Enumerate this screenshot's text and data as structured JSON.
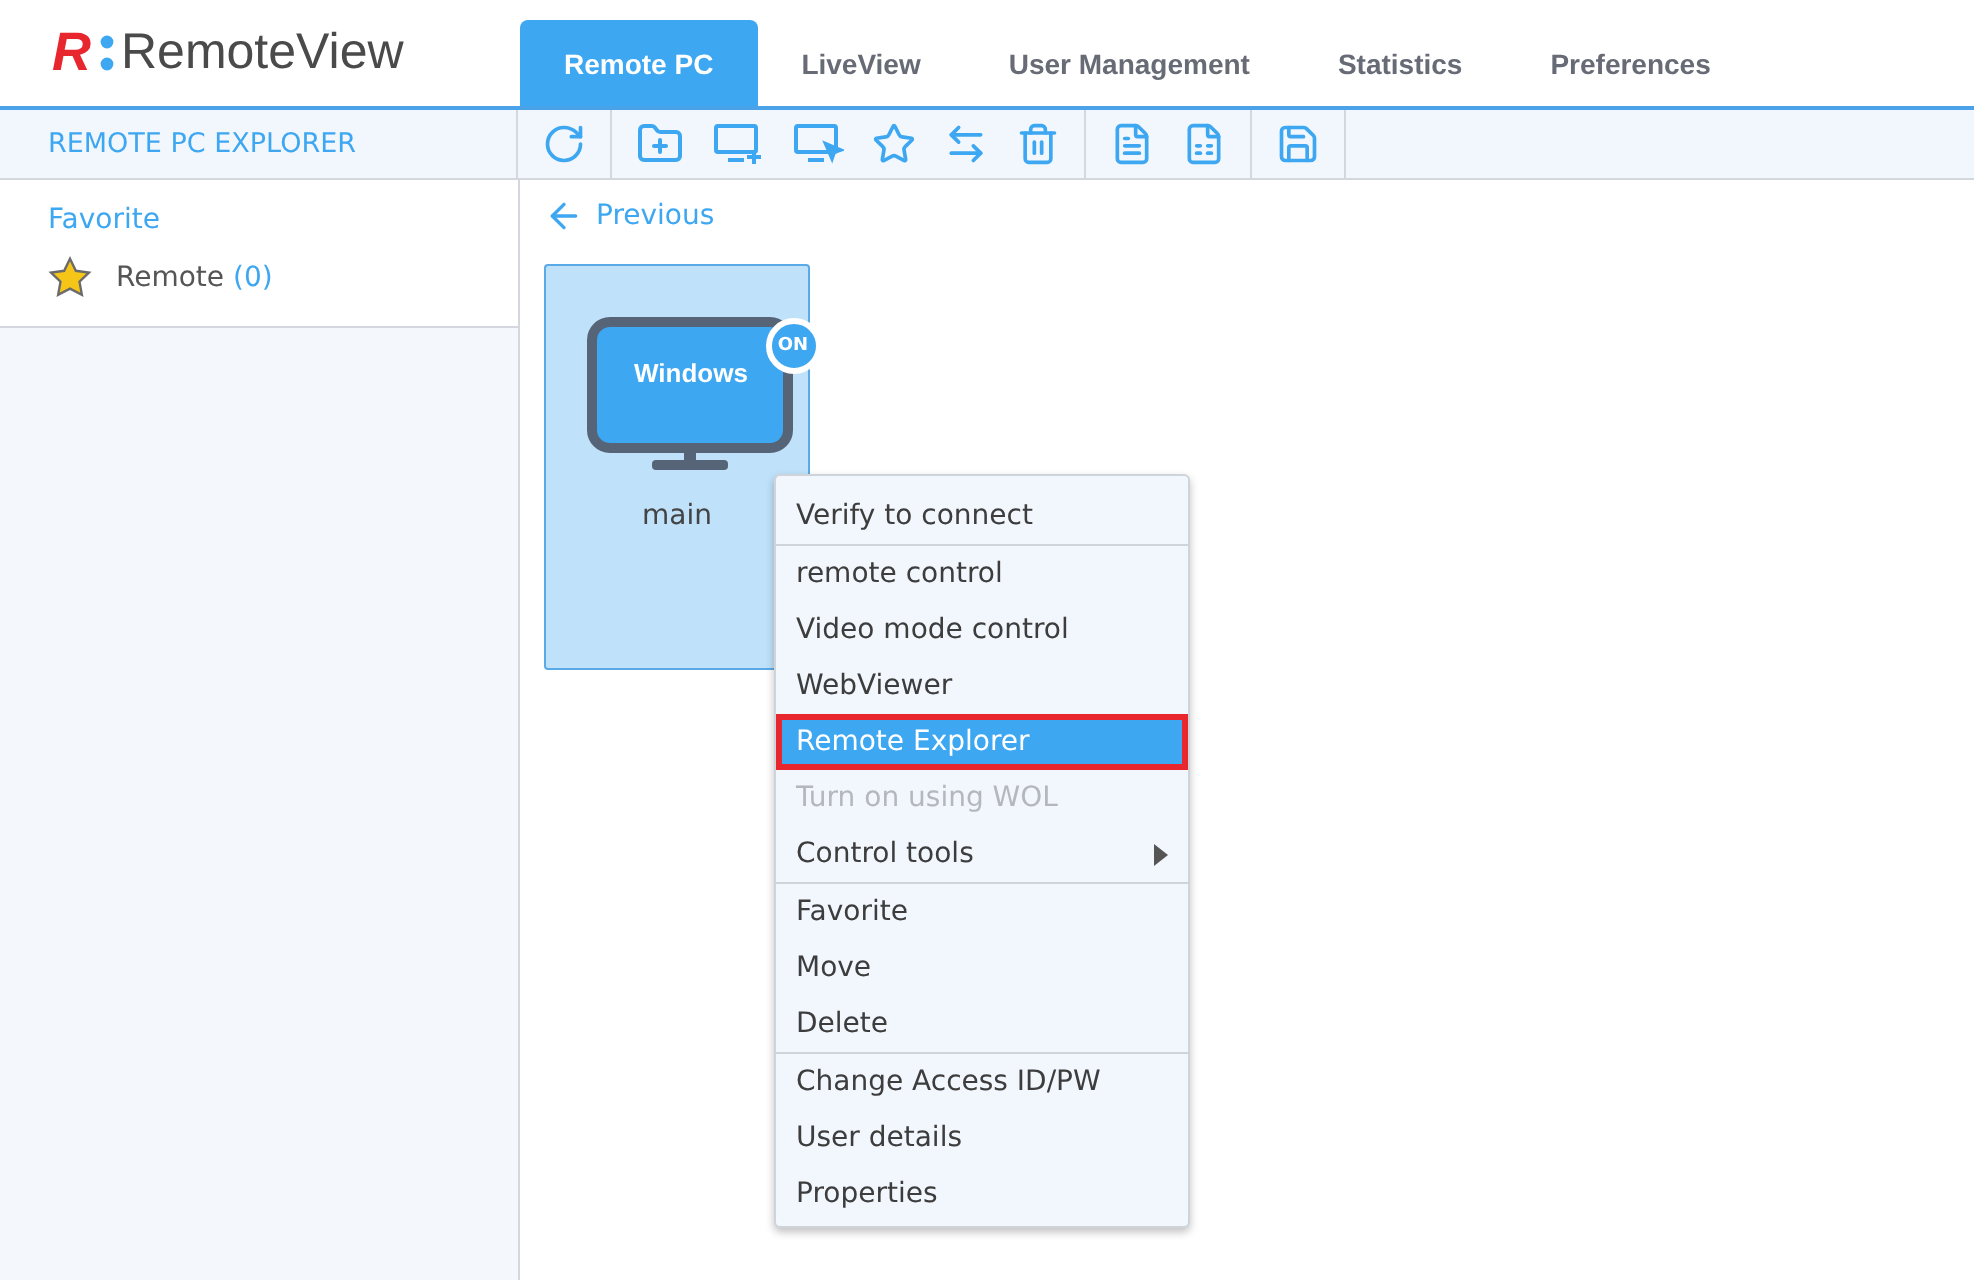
{
  "logo": {
    "mark": "R",
    "name": "RemoteView"
  },
  "tabs": [
    {
      "label": "Remote PC",
      "selected": true
    },
    {
      "label": "LiveView",
      "selected": false
    },
    {
      "label": "User Management",
      "selected": false
    },
    {
      "label": "Statistics",
      "selected": false
    },
    {
      "label": "Preferences",
      "selected": false
    }
  ],
  "sidebar": {
    "title": "REMOTE PC EXPLORER",
    "section": "Favorite",
    "items": [
      {
        "label": "Remote",
        "count": "(0)"
      }
    ]
  },
  "nav": {
    "back": "Previous"
  },
  "devices": [
    {
      "screen_text": "Windows",
      "status": "ON",
      "on": true,
      "name": "main",
      "selected": true
    }
  ],
  "context_menu": [
    [
      {
        "label": "Verify to connect",
        "disabled": false,
        "selected": false,
        "outlined": false,
        "submenu": false
      }
    ],
    [
      {
        "label": "remote control",
        "disabled": false,
        "selected": false,
        "outlined": false,
        "submenu": false
      },
      {
        "label": "Video mode control",
        "disabled": false,
        "selected": false,
        "outlined": false,
        "submenu": false
      },
      {
        "label": "WebViewer",
        "disabled": false,
        "selected": false,
        "outlined": false,
        "submenu": false
      },
      {
        "label": "Remote Explorer",
        "disabled": false,
        "selected": true,
        "outlined": true,
        "submenu": false
      },
      {
        "label": "Turn on using WOL",
        "disabled": true,
        "selected": false,
        "outlined": false,
        "submenu": false
      },
      {
        "label": "Control tools",
        "disabled": false,
        "selected": false,
        "outlined": false,
        "submenu": true
      }
    ],
    [
      {
        "label": "Favorite",
        "disabled": false,
        "selected": false,
        "outlined": false,
        "submenu": false
      },
      {
        "label": "Move",
        "disabled": false,
        "selected": false,
        "outlined": false,
        "submenu": false
      },
      {
        "label": "Delete",
        "disabled": false,
        "selected": false,
        "outlined": false,
        "submenu": false
      }
    ],
    [
      {
        "label": "Change Access ID/PW",
        "disabled": false,
        "selected": false,
        "outlined": false,
        "submenu": false
      },
      {
        "label": "User details",
        "disabled": false,
        "selected": false,
        "outlined": false,
        "submenu": false
      },
      {
        "label": "Properties",
        "disabled": false,
        "selected": false,
        "outlined": false,
        "submenu": false
      }
    ]
  ]
}
